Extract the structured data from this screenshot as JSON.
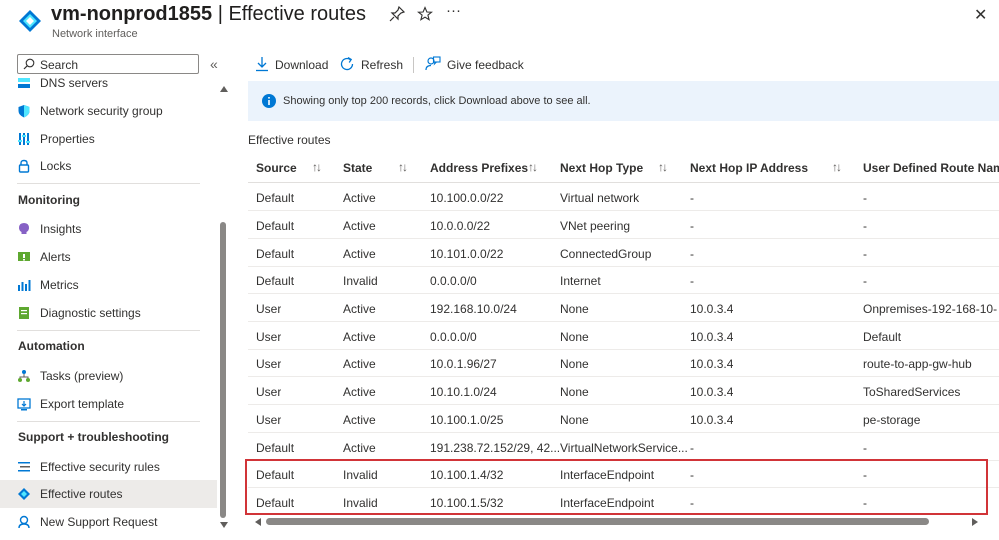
{
  "header": {
    "resource_name": "vm-nonprod1855",
    "separator": " | ",
    "page_name": "Effective routes",
    "subtitle": "Network interface"
  },
  "sidebar": {
    "search_placeholder": "Search",
    "items_top": [
      {
        "label": "DNS servers",
        "icon": "dns-icon"
      },
      {
        "label": "Network security group",
        "icon": "shield-icon"
      },
      {
        "label": "Properties",
        "icon": "properties-icon"
      },
      {
        "label": "Locks",
        "icon": "lock-icon"
      }
    ],
    "sections": [
      {
        "title": "Monitoring",
        "items": [
          {
            "label": "Insights",
            "icon": "insights-icon"
          },
          {
            "label": "Alerts",
            "icon": "alerts-icon"
          },
          {
            "label": "Metrics",
            "icon": "metrics-icon"
          },
          {
            "label": "Diagnostic settings",
            "icon": "diagnostic-icon"
          }
        ]
      },
      {
        "title": "Automation",
        "items": [
          {
            "label": "Tasks (preview)",
            "icon": "tasks-icon"
          },
          {
            "label": "Export template",
            "icon": "export-icon"
          }
        ]
      },
      {
        "title": "Support + troubleshooting",
        "items": [
          {
            "label": "Effective security rules",
            "icon": "rules-icon"
          },
          {
            "label": "Effective routes",
            "icon": "routes-icon",
            "selected": true
          },
          {
            "label": "New Support Request",
            "icon": "support-icon"
          }
        ]
      }
    ]
  },
  "toolbar": {
    "download_label": "Download",
    "refresh_label": "Refresh",
    "feedback_label": "Give feedback"
  },
  "banner": {
    "text": "Showing only top 200 records, click Download above to see all."
  },
  "table": {
    "title": "Effective routes",
    "columns": [
      "Source",
      "State",
      "Address Prefixes",
      "Next Hop Type",
      "Next Hop IP Address",
      "User Defined Route Nam"
    ],
    "rows": [
      [
        "Default",
        "Active",
        "10.100.0.0/22",
        "Virtual network",
        "-",
        "-"
      ],
      [
        "Default",
        "Active",
        "10.0.0.0/22",
        "VNet peering",
        "-",
        "-"
      ],
      [
        "Default",
        "Active",
        "10.101.0.0/22",
        "ConnectedGroup",
        "-",
        "-"
      ],
      [
        "Default",
        "Invalid",
        "0.0.0.0/0",
        "Internet",
        "-",
        "-"
      ],
      [
        "User",
        "Active",
        "192.168.10.0/24",
        "None",
        "10.0.3.4",
        "Onpremises-192-168-10-"
      ],
      [
        "User",
        "Active",
        "0.0.0.0/0",
        "None",
        "10.0.3.4",
        "Default"
      ],
      [
        "User",
        "Active",
        "10.0.1.96/27",
        "None",
        "10.0.3.4",
        "route-to-app-gw-hub"
      ],
      [
        "User",
        "Active",
        "10.10.1.0/24",
        "None",
        "10.0.3.4",
        "ToSharedServices"
      ],
      [
        "User",
        "Active",
        "10.100.1.0/25",
        "None",
        "10.0.3.4",
        "pe-storage"
      ],
      [
        "Default",
        "Active",
        "191.238.72.152/29, 42...",
        "VirtualNetworkService...",
        "-",
        "-"
      ],
      [
        "Default",
        "Invalid",
        "10.100.1.4/32",
        "InterfaceEndpoint",
        "-",
        "-"
      ],
      [
        "Default",
        "Invalid",
        "10.100.1.5/32",
        "InterfaceEndpoint",
        "-",
        "-"
      ]
    ]
  },
  "colors": {
    "accent": "#0078d4",
    "highlight_border": "#d13438",
    "banner_bg": "#ebf3fc"
  }
}
